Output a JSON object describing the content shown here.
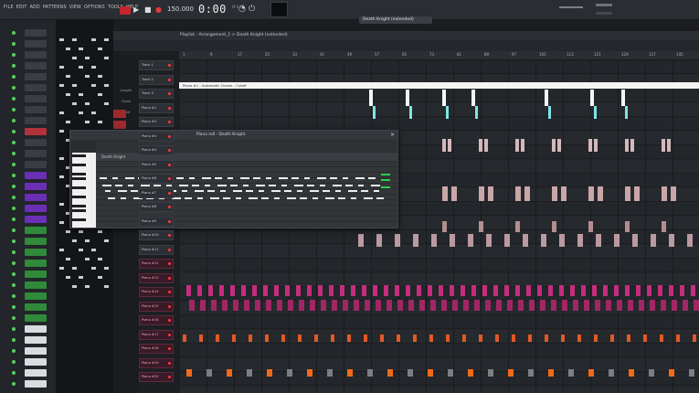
{
  "menu": [
    "FILE",
    "EDIT",
    "ADD",
    "PATTERNS",
    "VIEW",
    "OPTIONS",
    "TOOLS",
    "HELP"
  ],
  "transport": {
    "play": "▶",
    "stop": "■",
    "record": "●",
    "tempo": "150.000",
    "time": "0:00",
    "time_sub": "M:S:CS"
  },
  "playlist": {
    "title": "Playlist - Arrangement_1 > Death Knight (extended)",
    "pattern_name": "Death Knight (extended)",
    "ruler": [
      "1",
      "9",
      "17",
      "25",
      "33",
      "41",
      "49",
      "57",
      "65",
      "73",
      "81",
      "89",
      "97",
      "105",
      "113",
      "121",
      "129",
      "137",
      "145"
    ],
    "automation_label": "Piano #1 - Automatic Clones - Cutoff",
    "side_labels": [
      "Length",
      "Clone",
      "Split"
    ]
  },
  "piano_roll": {
    "title": "Piano roll - Death Knight",
    "header_label": "Death Knight",
    "close": "×"
  },
  "tracks": [
    "Track 1",
    "Track 2",
    "Track 3",
    "Piano #1",
    "Piano #2",
    "Piano #3",
    "Piano #4",
    "Piano #5",
    "Piano #6",
    "Piano #7",
    "Piano #8",
    "Piano #9",
    "Piano #10",
    "Piano #11",
    "Piano #12",
    "Piano #13",
    "Piano #14",
    "Piano #15",
    "Piano #16",
    "Piano #17",
    "Piano #18",
    "Piano #19",
    "Piano #20"
  ],
  "colors": {
    "accent_red": "#c8252d",
    "clip_pink": "#c42d7e",
    "clip_orange": "#f06a1a",
    "clip_cyan": "#7ee4e8",
    "note_green": "#27d04e"
  }
}
